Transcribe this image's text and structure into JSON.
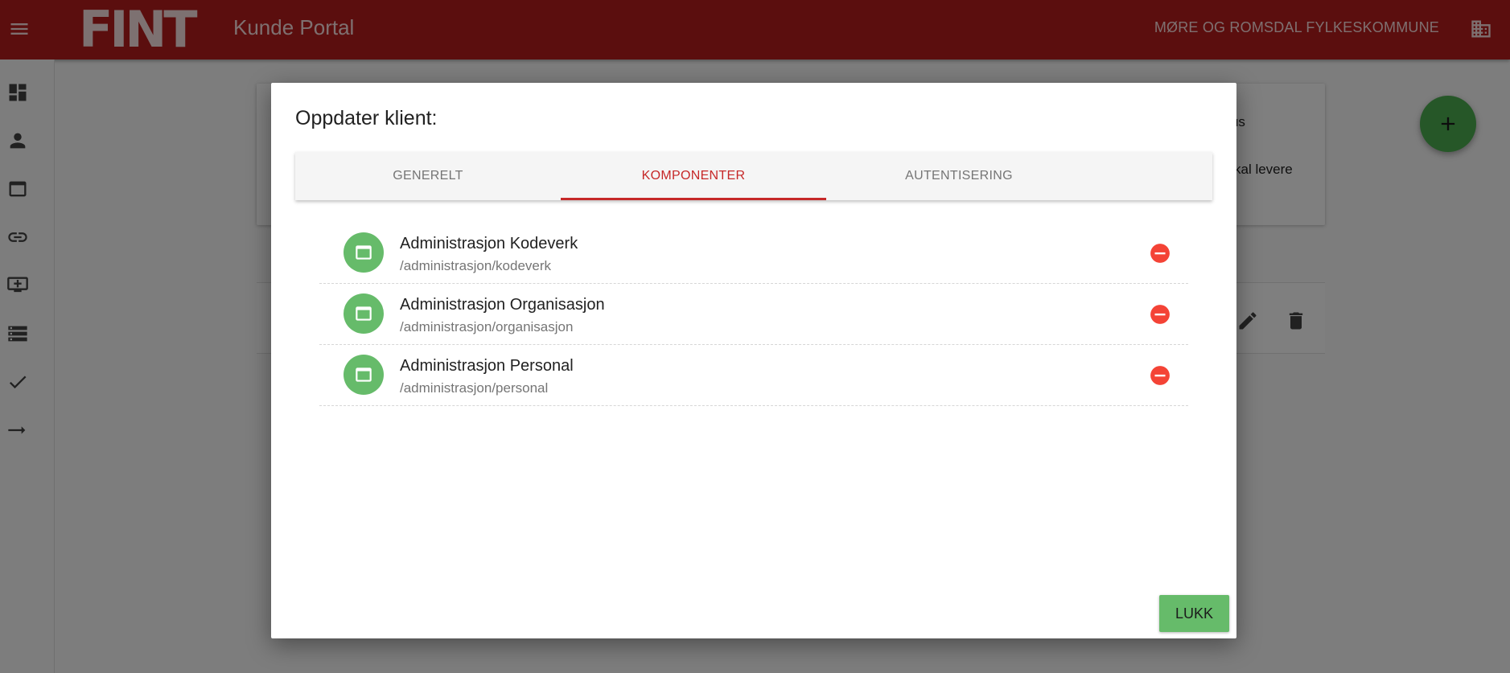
{
  "header": {
    "logo_text": "FINT",
    "app_title": "Kunde Portal",
    "org_name": "MØRE OG ROMSDAL FYLKESKOMMUNE",
    "brand_color": "#b71c1c"
  },
  "sidenav": {
    "icons": [
      "dashboard-icon",
      "person-icon",
      "web-window-icon",
      "link-icon",
      "add-to-queue-icon",
      "list-icon",
      "check-icon",
      "arrow-right-icon"
    ]
  },
  "background": {
    "text1": "sbus",
    "text2": "kal levere"
  },
  "dialog": {
    "title": "Oppdater klient:",
    "tabs": [
      {
        "label": "GENERELT"
      },
      {
        "label": "KOMPONENTER"
      },
      {
        "label": "AUTENTISERING"
      }
    ],
    "active_tab": "KOMPONENTER",
    "components": [
      {
        "name": "Administrasjon Kodeverk",
        "path": "/administrasjon/kodeverk"
      },
      {
        "name": "Administrasjon Organisasjon",
        "path": "/administrasjon/organisasjon"
      },
      {
        "name": "Administrasjon Personal",
        "path": "/administrasjon/personal"
      }
    ],
    "close_label": "LUKK"
  },
  "colors": {
    "accent": "#c62828",
    "success": "#66bb6a",
    "remove": "#f44336"
  }
}
